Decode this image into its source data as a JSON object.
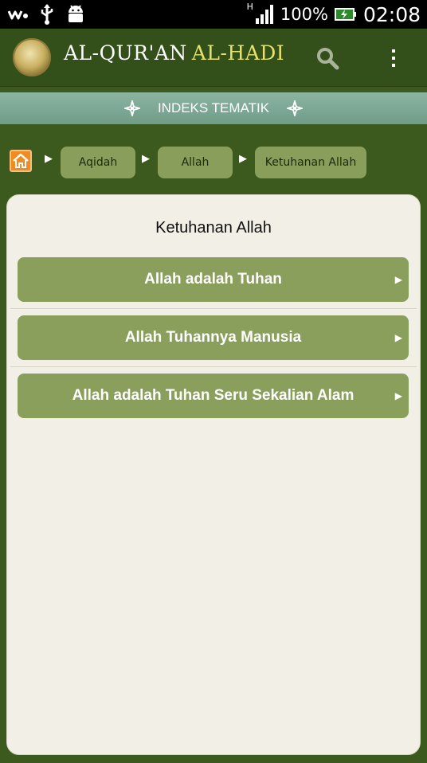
{
  "status_bar": {
    "network_type": "H",
    "battery": "100%",
    "time": "02:08"
  },
  "app_bar": {
    "title_part1": "AL-QUR'AN",
    "title_part2": "AL-HADI",
    "icons": [
      "search-icon",
      "overflow-menu-icon"
    ]
  },
  "section_header": {
    "label": "INDEKS TEMATIK"
  },
  "breadcrumb": {
    "home_icon": "home-icon",
    "items": [
      "Aqidah",
      "Allah",
      "Ketuhanan Allah"
    ]
  },
  "panel": {
    "title": "Ketuhanan Allah",
    "topics": [
      {
        "label": "Allah adalah Tuhan"
      },
      {
        "label": "Allah Tuhannya Manusia"
      },
      {
        "label": "Allah adalah Tuhan Seru Sekalian Alam"
      }
    ]
  },
  "colors": {
    "app_bar": "#34501a",
    "background": "#3c5a1e",
    "section_header": "#7aa692",
    "topic_button": "#8a9f5c",
    "panel": "#f2f0e6",
    "home_button": "#f08a22",
    "title_accent": "#e7e36a"
  }
}
